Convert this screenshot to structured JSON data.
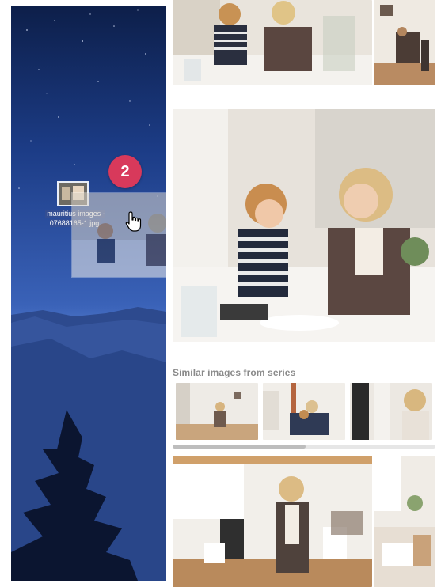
{
  "drag": {
    "step_number": "2",
    "file_name": "mauritius images - 07688165-1.jpg"
  },
  "panel": {
    "section_title": "Similar images from series"
  },
  "colors": {
    "badge": "#d8395b",
    "sky": "#1c3c86"
  },
  "icons": [
    "hand-cursor-icon",
    "image-file-icon"
  ]
}
